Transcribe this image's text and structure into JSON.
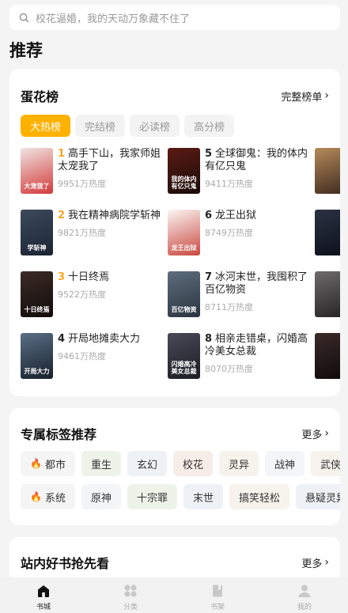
{
  "search": {
    "placeholder": "校花逼婚，我的天动万象藏不住了"
  },
  "page_title": "推荐",
  "ranking": {
    "title": "蛋花榜",
    "more": "完整榜单",
    "tabs": [
      "大热榜",
      "完结榜",
      "必读榜",
      "高分榜"
    ],
    "active_tab": 0,
    "books": [
      {
        "rank": "1",
        "title": "高手下山，我家师姐太宠我了",
        "heat": "9951万热度",
        "cover_text": "大宠我了",
        "cover_colors": [
          "#f1e4e2",
          "#d23a3a"
        ]
      },
      {
        "rank": "5",
        "title": "全球御鬼：我的体内有亿只鬼",
        "heat": "9411万热度",
        "cover_text": "我的体内有亿只鬼",
        "cover_colors": [
          "#5a1b14",
          "#1a0b08"
        ]
      },
      {
        "rank": "",
        "title": "",
        "heat": "",
        "cover_text": "",
        "cover_colors": [
          "#b58a5a",
          "#3d2a1e"
        ]
      },
      {
        "rank": "2",
        "title": "我在精神病院学斩神",
        "heat": "9821万热度",
        "cover_text": "学斩神",
        "cover_colors": [
          "#3c4a5c",
          "#1b2433"
        ]
      },
      {
        "rank": "6",
        "title": "龙王出狱",
        "heat": "8749万热度",
        "cover_text": "龙王出狱",
        "cover_colors": [
          "#fbf6f4",
          "#c9483f"
        ]
      },
      {
        "rank": "",
        "title": "",
        "heat": "",
        "cover_text": "",
        "cover_colors": [
          "#2a3244",
          "#0c1019"
        ]
      },
      {
        "rank": "3",
        "title": "十日终焉",
        "heat": "9522万热度",
        "cover_text": "十日终焉",
        "cover_colors": [
          "#3b2a26",
          "#120c0b"
        ]
      },
      {
        "rank": "7",
        "title": "冰河末世，我囤积了百亿物资",
        "heat": "8711万热度",
        "cover_text": "百亿物资",
        "cover_colors": [
          "#5d6d7c",
          "#2b3540"
        ]
      },
      {
        "rank": "",
        "title": "",
        "heat": "",
        "cover_text": "",
        "cover_colors": [
          "#6d6b6b",
          "#242222"
        ]
      },
      {
        "rank": "4",
        "title": "开局地摊卖大力",
        "heat": "9461万热度",
        "cover_text": "开局大力",
        "cover_colors": [
          "#5a6f86",
          "#17202b"
        ]
      },
      {
        "rank": "8",
        "title": "相亲走错桌，闪婚高冷美女总裁",
        "heat": "8070万热度",
        "cover_text": "闪婚高冷美女总裁",
        "cover_colors": [
          "#4a4a58",
          "#1c1c24"
        ]
      },
      {
        "rank": "",
        "title": "",
        "heat": "",
        "cover_text": "",
        "cover_colors": [
          "#3a2b2a",
          "#0e0a09"
        ]
      }
    ]
  },
  "tags": {
    "title": "专属标签推荐",
    "more": "更多",
    "rows": [
      [
        {
          "label": "都市",
          "fire": true,
          "bg": "#f5f5f5"
        },
        {
          "label": "重生",
          "fire": false,
          "bg": "#eef3ea"
        },
        {
          "label": "玄幻",
          "fire": false,
          "bg": "#eef1f6"
        },
        {
          "label": "校花",
          "fire": false,
          "bg": "#f6ece8"
        },
        {
          "label": "灵异",
          "fire": false,
          "bg": "#f6f3ec"
        },
        {
          "label": "战神",
          "fire": false,
          "bg": "#f4f5f7"
        },
        {
          "label": "武侠修",
          "fire": false,
          "bg": "#f6f3ec"
        }
      ],
      [
        {
          "label": "系统",
          "fire": true,
          "bg": "#f5f5f5"
        },
        {
          "label": "原神",
          "fire": false,
          "bg": "#f4f5f7"
        },
        {
          "label": "十宗罪",
          "fire": false,
          "bg": "#eef3ea"
        },
        {
          "label": "末世",
          "fire": false,
          "bg": "#eef1f6"
        },
        {
          "label": "搞笑轻松",
          "fire": false,
          "bg": "#f6f3ec"
        },
        {
          "label": "悬疑灵异",
          "fire": false,
          "bg": "#eef1f6"
        }
      ]
    ]
  },
  "good_books": {
    "title": "站内好书抢先看",
    "more": "更多"
  },
  "tabbar": {
    "items": [
      {
        "label": "书城",
        "icon": "home-icon",
        "active": true
      },
      {
        "label": "分类",
        "icon": "category-icon",
        "active": false
      },
      {
        "label": "书架",
        "icon": "bookshelf-icon",
        "active": false
      },
      {
        "label": "我的",
        "icon": "profile-icon",
        "active": false
      }
    ]
  }
}
